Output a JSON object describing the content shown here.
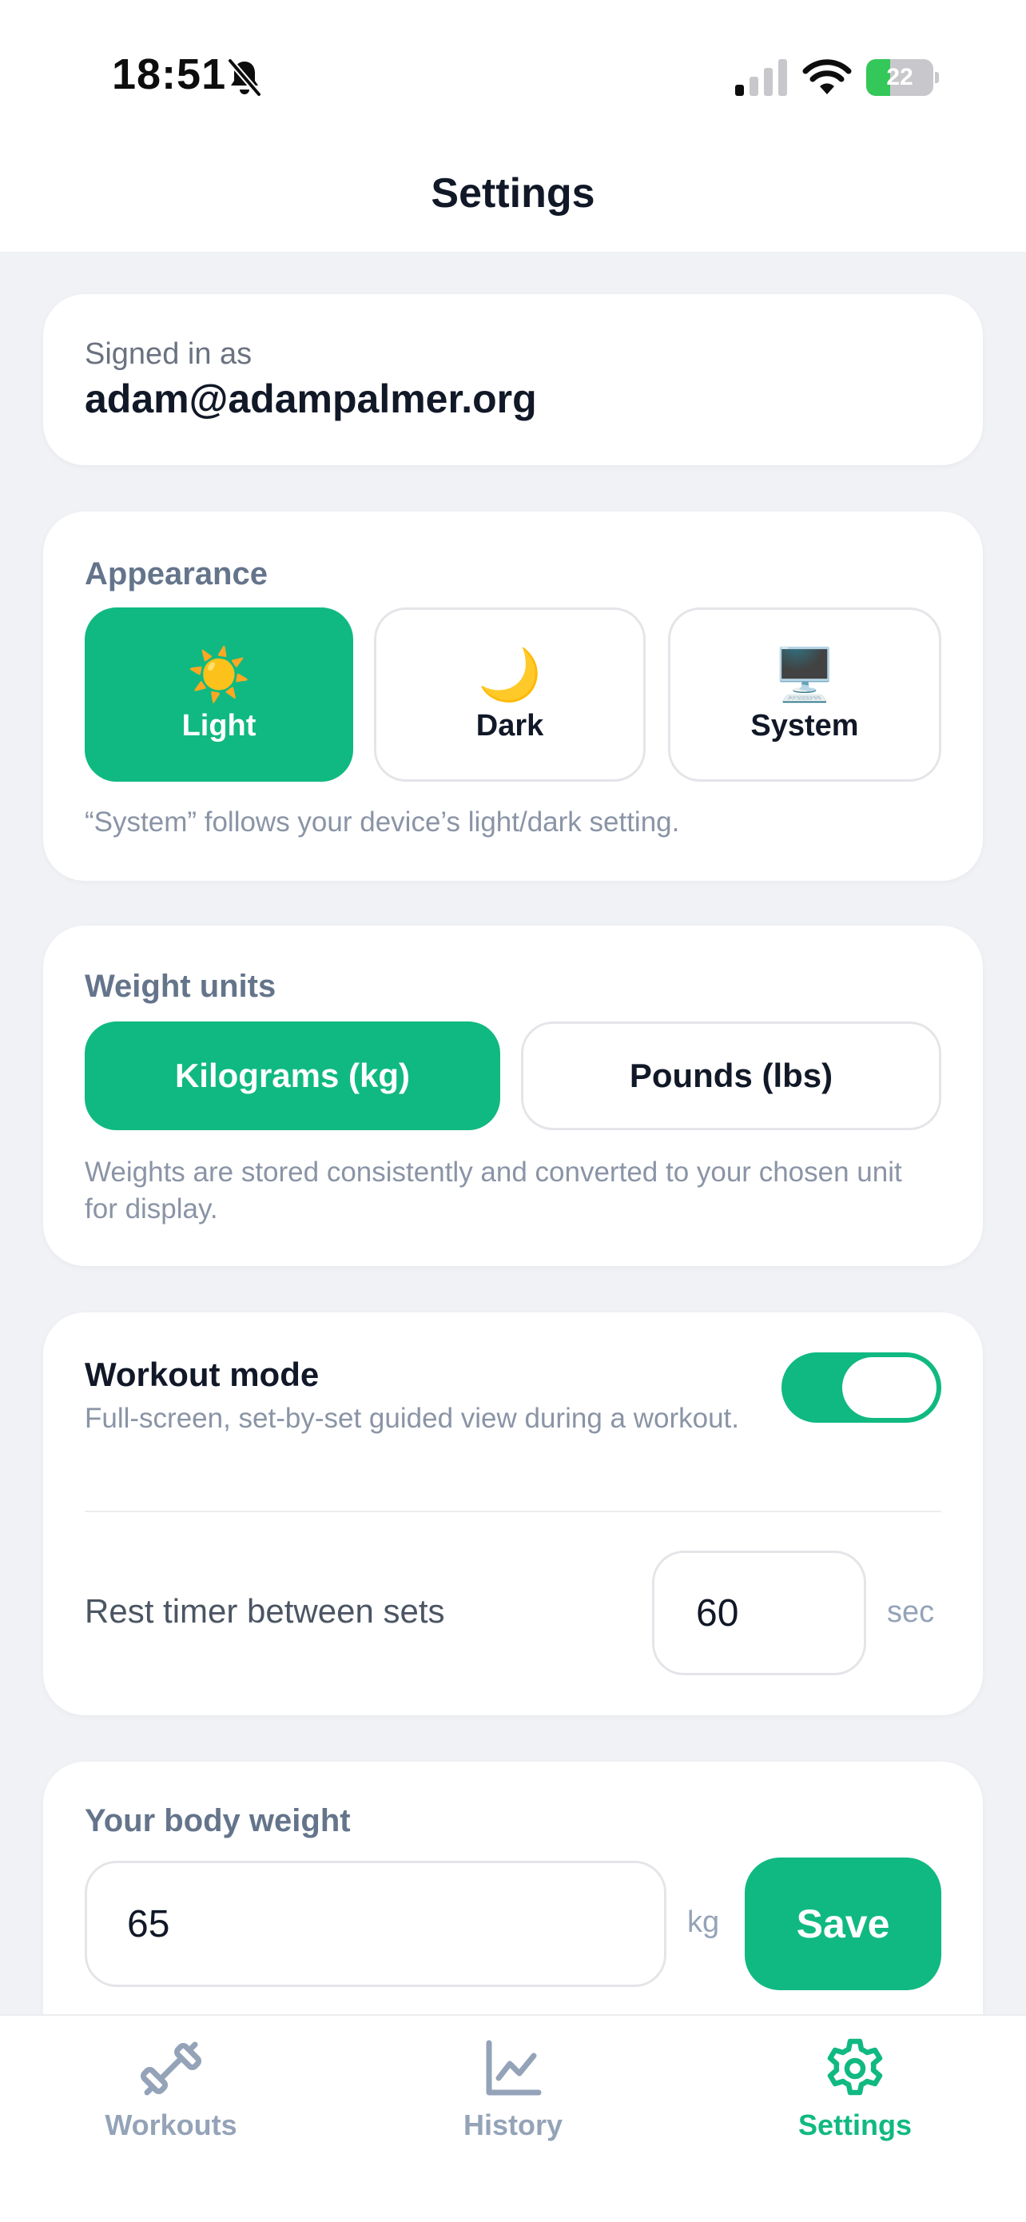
{
  "status_bar": {
    "time": "18:51",
    "battery_level": "22",
    "icons": [
      "bell-slash-icon",
      "cellular-signal-icon",
      "wifi-icon",
      "battery-icon"
    ]
  },
  "header": {
    "title": "Settings"
  },
  "account": {
    "label": "Signed in as",
    "email": "adam@adampalmer.org"
  },
  "appearance": {
    "label": "Appearance",
    "options": [
      {
        "label": "Light",
        "emoji": "☀️",
        "selected": true
      },
      {
        "label": "Dark",
        "emoji": "🌙",
        "selected": false
      },
      {
        "label": "System",
        "emoji": "🖥️",
        "selected": false
      }
    ],
    "help": "“System” follows your device’s light/dark setting."
  },
  "weight_units": {
    "label": "Weight units",
    "options": [
      {
        "label": "Kilograms (kg)",
        "selected": true
      },
      {
        "label": "Pounds (lbs)",
        "selected": false
      }
    ],
    "help": "Weights are stored consistently and converted to your chosen unit for display."
  },
  "workout_mode": {
    "title": "Workout mode",
    "description": "Full-screen, set-by-set guided view during a workout.",
    "enabled": true,
    "rest_timer_label": "Rest timer between sets",
    "rest_timer_value": "60",
    "rest_timer_unit": "sec"
  },
  "body_weight": {
    "label": "Your body weight",
    "value": "65",
    "unit": "kg",
    "save_label": "Save"
  },
  "tabbar": {
    "tabs": [
      {
        "label": "Workouts",
        "icon": "dumbbell-icon",
        "active": false
      },
      {
        "label": "History",
        "icon": "chart-line-icon",
        "active": false
      },
      {
        "label": "Settings",
        "icon": "gear-icon",
        "active": true
      }
    ]
  },
  "colors": {
    "accent": "#10B981",
    "background": "#F1F2F5",
    "card": "#FFFFFF",
    "muted_text": "#64748B",
    "inactive_tab": "#94A3B8"
  }
}
